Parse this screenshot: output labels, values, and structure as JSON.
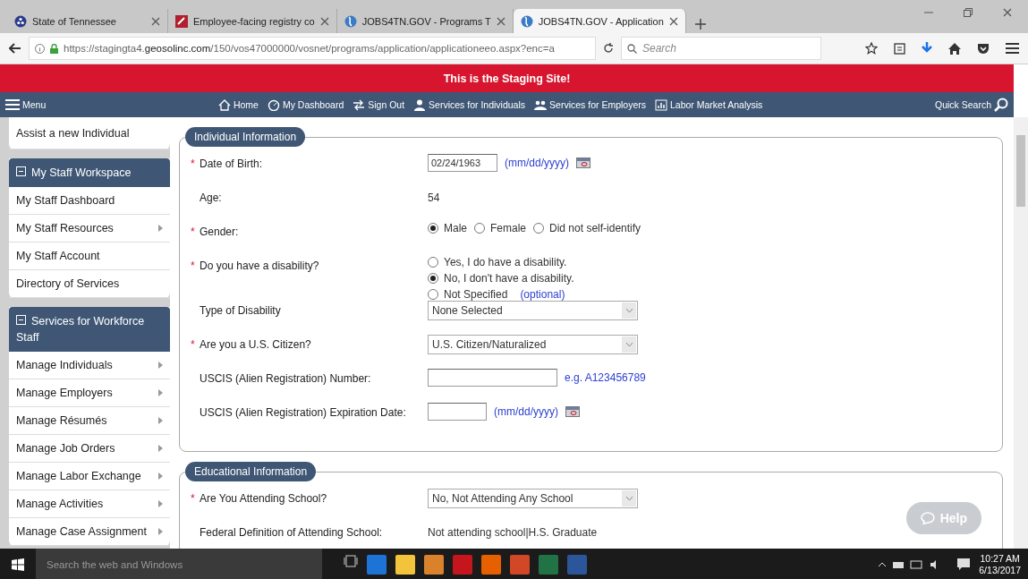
{
  "browser": {
    "tabs": [
      {
        "title": "State of Tennessee",
        "selected": false
      },
      {
        "title": "Employee-facing registry co",
        "selected": false
      },
      {
        "title": "JOBS4TN.GOV - Programs T",
        "selected": false
      },
      {
        "title": "JOBS4TN.GOV - Application",
        "selected": true
      }
    ],
    "url_prefix": "https://stagingta4.",
    "url_domain": "geosolinc.com",
    "url_rest": "/150/vos47000000/vosnet/programs/application/applicationeeo.aspx?enc=a",
    "search_placeholder": "Search"
  },
  "banner": "This is the Staging Site!",
  "nav": {
    "menu": "Menu",
    "links": [
      {
        "label": "Home"
      },
      {
        "label": "My Dashboard"
      },
      {
        "label": "Sign Out"
      },
      {
        "label": "Services for Individuals"
      },
      {
        "label": "Services for Employers"
      },
      {
        "label": "Labor Market Analysis"
      }
    ],
    "quick_search": "Quick Search"
  },
  "sidebar": [
    {
      "items": [
        {
          "label": "Assist a new Individual",
          "submenu": false
        }
      ]
    },
    {
      "title": "My Staff Workspace",
      "expanded": true,
      "items": [
        {
          "label": "My Staff Dashboard",
          "submenu": false
        },
        {
          "label": "My Staff Resources",
          "submenu": true
        },
        {
          "label": "My Staff Account",
          "submenu": false
        },
        {
          "label": "Directory of Services",
          "submenu": false
        }
      ]
    },
    {
      "title": "Services for Workforce Staff",
      "expanded": true,
      "items": [
        {
          "label": "Manage Individuals",
          "submenu": true
        },
        {
          "label": "Manage Employers",
          "submenu": true
        },
        {
          "label": "Manage Résumés",
          "submenu": true
        },
        {
          "label": "Manage Job Orders",
          "submenu": true
        },
        {
          "label": "Manage Labor Exchange",
          "submenu": true
        },
        {
          "label": "Manage Activities",
          "submenu": true
        },
        {
          "label": "Manage Case Assignment",
          "submenu": true
        }
      ]
    }
  ],
  "sections": [
    {
      "title": "Individual Information",
      "fields": [
        {
          "kind": "date",
          "marker": "*",
          "label": "Date of Birth:",
          "value": "02/24/1963",
          "hint": "(mm/dd/yyyy)"
        },
        {
          "kind": "text",
          "label": "Age:",
          "value": "54"
        },
        {
          "kind": "radio",
          "marker": "*",
          "label": "Gender:",
          "inline": true,
          "options": [
            {
              "label": "Male",
              "selected": true
            },
            {
              "label": "Female",
              "selected": false
            },
            {
              "label": "Did not self-identify",
              "selected": false
            }
          ]
        },
        {
          "kind": "radio",
          "marker": "*",
          "label": "Do you have a disability?",
          "inline": false,
          "options": [
            {
              "label": "Yes, I do have a disability.",
              "selected": false
            },
            {
              "label": "No, I don't have a disability.",
              "selected": true
            },
            {
              "label": "Not Specified",
              "selected": false,
              "note": "(optional)"
            }
          ]
        },
        {
          "kind": "select",
          "label": "Type of Disability",
          "value": "None Selected"
        },
        {
          "kind": "select",
          "marker": "*",
          "label": "Are you a U.S. Citizen?",
          "value": "U.S. Citizen/Naturalized"
        },
        {
          "kind": "input",
          "label": "USCIS (Alien Registration) Number:",
          "hint": "e.g. A123456789"
        },
        {
          "kind": "date",
          "label": "USCIS (Alien Registration) Expiration Date:",
          "hint": "(mm/dd/yyyy)"
        }
      ]
    },
    {
      "title": "Educational Information",
      "fields": [
        {
          "kind": "select",
          "marker": "*",
          "label": "Are You Attending School?",
          "value": "No, Not Attending Any School"
        },
        {
          "kind": "text",
          "label": "Federal Definition of Attending School:",
          "value": "Not attending school|H.S. Graduate"
        }
      ]
    }
  ],
  "help": "Help",
  "taskbar": {
    "search_placeholder": "Search the web and Windows",
    "time": "10:27 AM",
    "date": "6/13/2017"
  }
}
